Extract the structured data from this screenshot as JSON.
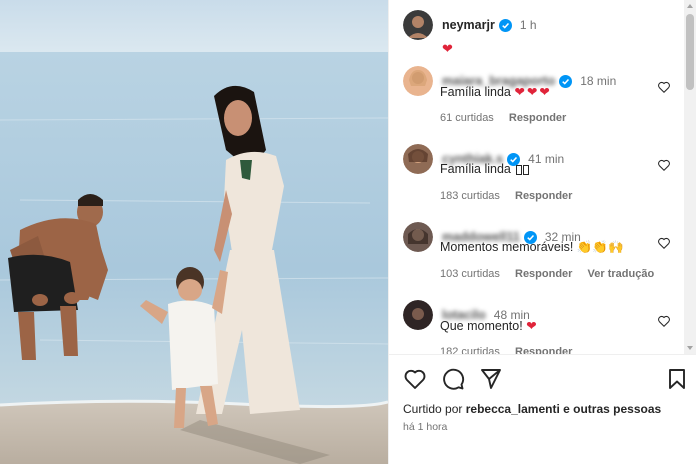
{
  "post": {
    "author": "neymarjr",
    "time": "1 h",
    "caption_emoji": "❤"
  },
  "comments": [
    {
      "user": "maiara_bragaporto",
      "time": "18 min",
      "text": "Família linda",
      "emoji": "❤❤❤",
      "likes": "61 curtidas",
      "reply": "Responder",
      "translate": ""
    },
    {
      "user": "cynthiak.s",
      "time": "41 min",
      "text": "Família linda",
      "emoji": "",
      "likes": "183 curtidas",
      "reply": "Responder",
      "translate": ""
    },
    {
      "user": "maddowell11",
      "time": "32 min",
      "text": "Momentos memoráveis!",
      "emoji": "👏👏🙌",
      "likes": "103 curtidas",
      "reply": "Responder",
      "translate": "Ver tradução"
    },
    {
      "user": "lotacilo",
      "time": "48 min",
      "text": "Que momento!",
      "emoji": "❤",
      "likes": "182 curtidas",
      "reply": "Responder",
      "translate": ""
    }
  ],
  "footer": {
    "liked_prefix": "Curtido por",
    "liked_user": "rebecca_lamenti",
    "liked_suffix": "e outras pessoas",
    "time_ago": "há 1 hora"
  },
  "icons": [
    "verified-badge-icon",
    "heart-icon",
    "comment-icon",
    "share-icon",
    "bookmark-icon"
  ],
  "colors": {
    "heart": "#e0243a",
    "verified": "#0095f6",
    "muted": "#737373"
  }
}
